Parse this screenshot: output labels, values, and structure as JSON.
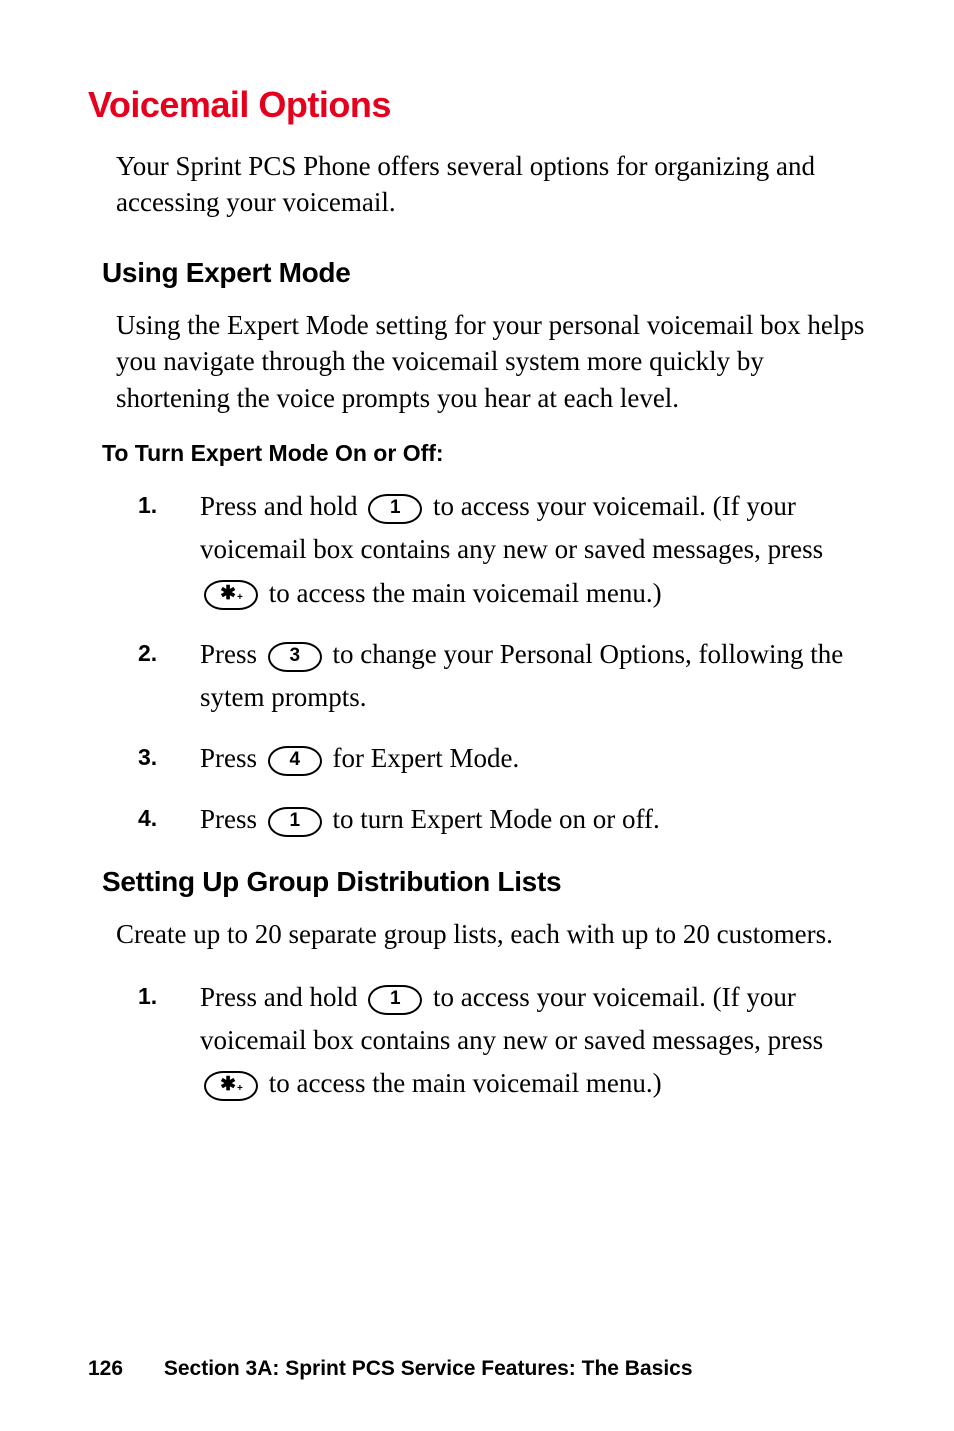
{
  "section": {
    "title": "Voicemail Options",
    "intro": "Your Sprint PCS Phone offers several options for organizing and accessing your voicemail."
  },
  "expert_mode": {
    "heading": "Using Expert Mode",
    "body": "Using the Expert Mode setting for your personal voicemail box helps you navigate through the voicemail system more quickly by shortening the voice prompts you hear at each level.",
    "instruction_title": "To Turn Expert Mode On or Off:",
    "steps": {
      "s1n": "1.",
      "s1a": "Press and hold ",
      "s1b": " to access your voicemail. (If your voicemail box contains any new or saved messages, press ",
      "s1c": " to access the main voicemail menu.)",
      "s2n": "2.",
      "s2a": "Press ",
      "s2b": " to change your Personal Options, following the sytem prompts.",
      "s3n": "3.",
      "s3a": "Press ",
      "s3b": " for Expert Mode.",
      "s4n": "4.",
      "s4a": "Press ",
      "s4b": " to turn Expert Mode on or off."
    }
  },
  "group_lists": {
    "heading": "Setting Up Group Distribution Lists",
    "body": "Create up to 20 separate group lists, each with up to 20 customers.",
    "steps": {
      "s1n": "1.",
      "s1a": "Press and hold ",
      "s1b": " to access your voicemail. (If your voicemail box contains any new or saved messages, press ",
      "s1c": " to access the main voicemail menu.)"
    }
  },
  "keys": {
    "one": "1",
    "three": "3",
    "four": "4",
    "star": "✱"
  },
  "footer": {
    "page": "126",
    "label": "Section 3A: Sprint PCS Service Features: The Basics"
  },
  "chart_data": null
}
